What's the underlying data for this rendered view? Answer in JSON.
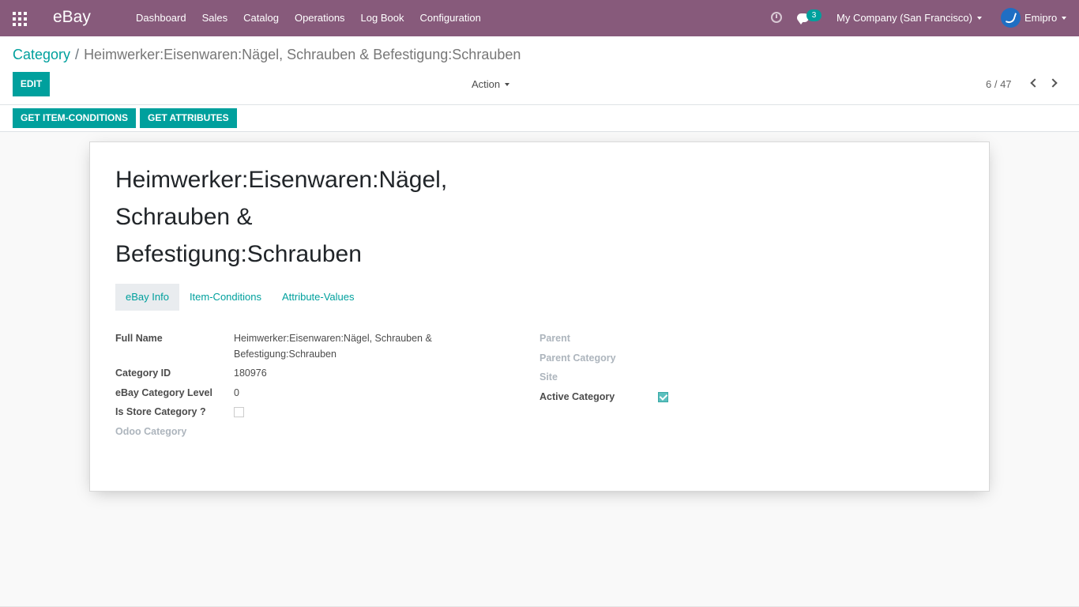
{
  "navbar": {
    "app_name": "eBay",
    "menu": [
      "Dashboard",
      "Sales",
      "Catalog",
      "Operations",
      "Log Book",
      "Configuration"
    ],
    "chat_count": "3",
    "company": "My Company (San Francisco)",
    "user": "Emipro",
    "bg_color": "#875a7b"
  },
  "control": {
    "breadcrumb_parent": "Category",
    "breadcrumb_sep": "/",
    "breadcrumb_current": "Heimwerker:Eisenwaren:Nägel, Schrauben & Befestigung:Schrauben",
    "edit_label": "EDIT",
    "action_label": "Action",
    "pager": "6 / 47"
  },
  "header_buttons": {
    "get_conditions": "GET ITEM-CONDITIONS",
    "get_attributes": "GET ATTRIBUTES"
  },
  "record": {
    "title_lines": [
      "Heimwerker:Eisenwaren:Nägel,",
      "Schrauben &",
      "Befestigung:Schrauben"
    ],
    "tabs": [
      "eBay Info",
      "Item-Conditions",
      "Attribute-Values"
    ],
    "active_tab": "eBay Info",
    "left": {
      "full_name_label": "Full Name",
      "full_name_line1": "Heimwerker:Eisenwaren:Nägel, Schrauben &",
      "full_name_line2": "Befestigung:Schrauben",
      "category_id_label": "Category ID",
      "category_id": "180976",
      "level_label": "eBay Category Level",
      "level": "0",
      "store_label": "Is Store Category ?",
      "store_checked": false,
      "odoo_label": "Odoo Category"
    },
    "right": {
      "parent_label": "Parent",
      "parent_category_label": "Parent Category",
      "site_label": "Site",
      "active_label": "Active Category",
      "active_checked": true
    }
  },
  "accent_color": "#00a09d"
}
